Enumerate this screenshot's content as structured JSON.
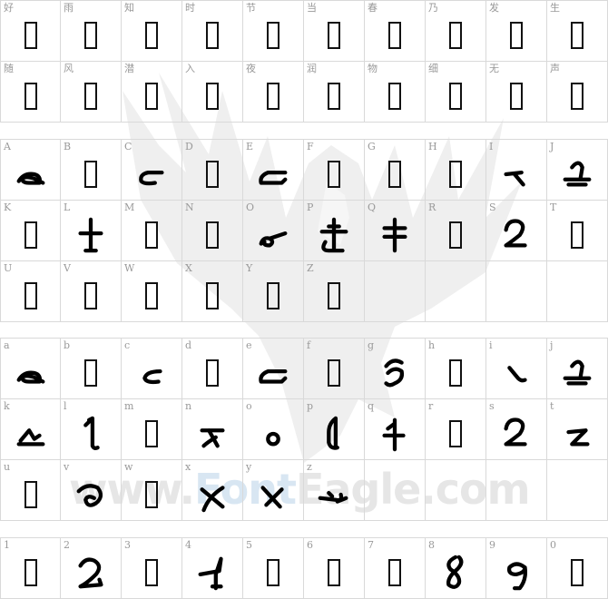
{
  "watermark": {
    "text_plain": "www.",
    "text_accent": "Font",
    "text_end": "Eagle.com"
  },
  "blocks": [
    {
      "rows": [
        [
          {
            "label": "好",
            "glyph": "tofu"
          },
          {
            "label": "雨",
            "glyph": "tofu"
          },
          {
            "label": "知",
            "glyph": "tofu"
          },
          {
            "label": "时",
            "glyph": "tofu"
          },
          {
            "label": "节",
            "glyph": "tofu"
          },
          {
            "label": "当",
            "glyph": "tofu"
          },
          {
            "label": "春",
            "glyph": "tofu"
          },
          {
            "label": "乃",
            "glyph": "tofu"
          },
          {
            "label": "发",
            "glyph": "tofu"
          },
          {
            "label": "生",
            "glyph": "tofu"
          }
        ],
        [
          {
            "label": "随",
            "glyph": "tofu"
          },
          {
            "label": "风",
            "glyph": "tofu"
          },
          {
            "label": "潜",
            "glyph": "tofu"
          },
          {
            "label": "入",
            "glyph": "tofu"
          },
          {
            "label": "夜",
            "glyph": "tofu"
          },
          {
            "label": "润",
            "glyph": "tofu"
          },
          {
            "label": "物",
            "glyph": "tofu"
          },
          {
            "label": "细",
            "glyph": "tofu"
          },
          {
            "label": "无",
            "glyph": "tofu"
          },
          {
            "label": "声",
            "glyph": "tofu"
          }
        ]
      ]
    },
    {
      "rows": [
        [
          {
            "label": "A",
            "glyph": "g-a"
          },
          {
            "label": "B",
            "glyph": "tofu"
          },
          {
            "label": "C",
            "glyph": "g-c"
          },
          {
            "label": "D",
            "glyph": "tofu"
          },
          {
            "label": "E",
            "glyph": "g-e"
          },
          {
            "label": "F",
            "glyph": "tofu"
          },
          {
            "label": "G",
            "glyph": "tofu"
          },
          {
            "label": "H",
            "glyph": "tofu"
          },
          {
            "label": "I",
            "glyph": "g-i"
          },
          {
            "label": "J",
            "glyph": "g-j"
          }
        ],
        [
          {
            "label": "K",
            "glyph": "tofu"
          },
          {
            "label": "L",
            "glyph": "g-l"
          },
          {
            "label": "M",
            "glyph": "tofu"
          },
          {
            "label": "N",
            "glyph": "tofu"
          },
          {
            "label": "O",
            "glyph": "g-o2"
          },
          {
            "label": "P",
            "glyph": "g-p"
          },
          {
            "label": "Q",
            "glyph": "g-q"
          },
          {
            "label": "R",
            "glyph": "tofu"
          },
          {
            "label": "S",
            "glyph": "g-s"
          },
          {
            "label": "T",
            "glyph": "tofu"
          }
        ],
        [
          {
            "label": "U",
            "glyph": "tofu"
          },
          {
            "label": "V",
            "glyph": "tofu"
          },
          {
            "label": "W",
            "glyph": "tofu"
          },
          {
            "label": "X",
            "glyph": "tofu"
          },
          {
            "label": "Y",
            "glyph": "tofu"
          },
          {
            "label": "Z",
            "glyph": "tofu"
          },
          {
            "label": "",
            "glyph": ""
          },
          {
            "label": "",
            "glyph": ""
          },
          {
            "label": "",
            "glyph": ""
          },
          {
            "label": "",
            "glyph": ""
          }
        ]
      ]
    },
    {
      "rows": [
        [
          {
            "label": "a",
            "glyph": "g-a"
          },
          {
            "label": "b",
            "glyph": "tofu"
          },
          {
            "label": "c",
            "glyph": "g-c2"
          },
          {
            "label": "d",
            "glyph": "tofu"
          },
          {
            "label": "e",
            "glyph": "g-e"
          },
          {
            "label": "f",
            "glyph": "tofu"
          },
          {
            "label": "g",
            "glyph": "g-g"
          },
          {
            "label": "h",
            "glyph": "tofu"
          },
          {
            "label": "i",
            "glyph": "g-i2"
          },
          {
            "label": "j",
            "glyph": "g-j"
          }
        ],
        [
          {
            "label": "k",
            "glyph": "g-k"
          },
          {
            "label": "l",
            "glyph": "g-l2"
          },
          {
            "label": "m",
            "glyph": "tofu"
          },
          {
            "label": "n",
            "glyph": "g-n"
          },
          {
            "label": "o",
            "glyph": "g-o"
          },
          {
            "label": "p",
            "glyph": "g-p2"
          },
          {
            "label": "q",
            "glyph": "g-q2"
          },
          {
            "label": "r",
            "glyph": "tofu"
          },
          {
            "label": "s",
            "glyph": "g-s"
          },
          {
            "label": "t",
            "glyph": "g-t"
          }
        ],
        [
          {
            "label": "u",
            "glyph": "tofu"
          },
          {
            "label": "v",
            "glyph": "g-v"
          },
          {
            "label": "w",
            "glyph": "tofu"
          },
          {
            "label": "x",
            "glyph": "g-x"
          },
          {
            "label": "y",
            "glyph": "g-y"
          },
          {
            "label": "z",
            "glyph": "g-z"
          },
          {
            "label": "",
            "glyph": ""
          },
          {
            "label": "",
            "glyph": ""
          },
          {
            "label": "",
            "glyph": ""
          },
          {
            "label": "",
            "glyph": ""
          }
        ]
      ]
    },
    {
      "rows": [
        [
          {
            "label": "1",
            "glyph": "tofu"
          },
          {
            "label": "2",
            "glyph": "g-2"
          },
          {
            "label": "3",
            "glyph": "tofu"
          },
          {
            "label": "4",
            "glyph": "g-4"
          },
          {
            "label": "5",
            "glyph": "tofu"
          },
          {
            "label": "6",
            "glyph": "tofu"
          },
          {
            "label": "7",
            "glyph": "tofu"
          },
          {
            "label": "8",
            "glyph": "g-8"
          },
          {
            "label": "9",
            "glyph": "g-9"
          },
          {
            "label": "0",
            "glyph": "tofu"
          }
        ]
      ]
    }
  ]
}
